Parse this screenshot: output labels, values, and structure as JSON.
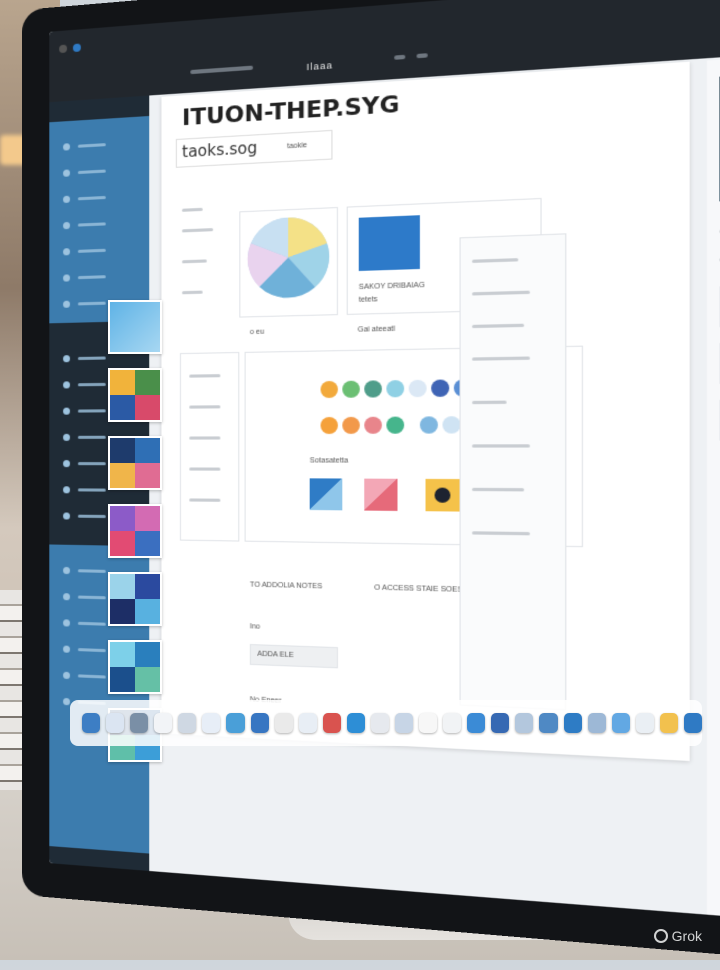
{
  "window": {
    "tab_title": "Ilaaa",
    "title": "ITUON-THEP.SYG",
    "subtitle": "taoks.sog",
    "subtitle_btn": "taokie"
  },
  "main": {
    "card_caption": "SAKOY DRIBAIAG",
    "card_caption_sub": "tetets",
    "row_label_left": "o eu",
    "row_label_right": "Gai ateeatl",
    "filter_label": "Sotasatetta",
    "footer_lines": [
      "TO ADDOLIA NOTES",
      "O ACCESS STAIE SOESTE",
      "Ino",
      "ADDA ELE",
      "No Eneer"
    ]
  },
  "palette": {
    "row1": [
      "#f2a93b",
      "#6bbf73",
      "#4f9d8a",
      "#8fd0e4",
      "#5a8fd4",
      "#3f64b5",
      "#e25b58",
      "#e05a47",
      "#2a2f3d",
      "#f08b35"
    ],
    "row2": [
      "#f5a13a",
      "#f2994a",
      "#e8858b",
      "#46b58c",
      "#7fb7e0",
      "#1b6fbd",
      "#2a4e8f",
      "#4aa3d8"
    ]
  },
  "dock_colors": [
    "#3d7ec4",
    "#dbe5f2",
    "#7a8fa6",
    "#f2f4f7",
    "#cfd8e3",
    "#e7eef7",
    "#4a9fd8",
    "#3776c2",
    "#eaeaea",
    "#e8eef5",
    "#d9534f",
    "#2d8ed6",
    "#e6e9ee",
    "#c7d5e6",
    "#f7f7f7",
    "#f1f3f5",
    "#3b8bd6",
    "#3669b3",
    "#b3c7dd",
    "#4f89c4",
    "#2e7cc5",
    "#9db8d6",
    "#62a8e3",
    "#eaeff4",
    "#f2c14e",
    "#2f7ac4"
  ],
  "watermark": "Grok"
}
